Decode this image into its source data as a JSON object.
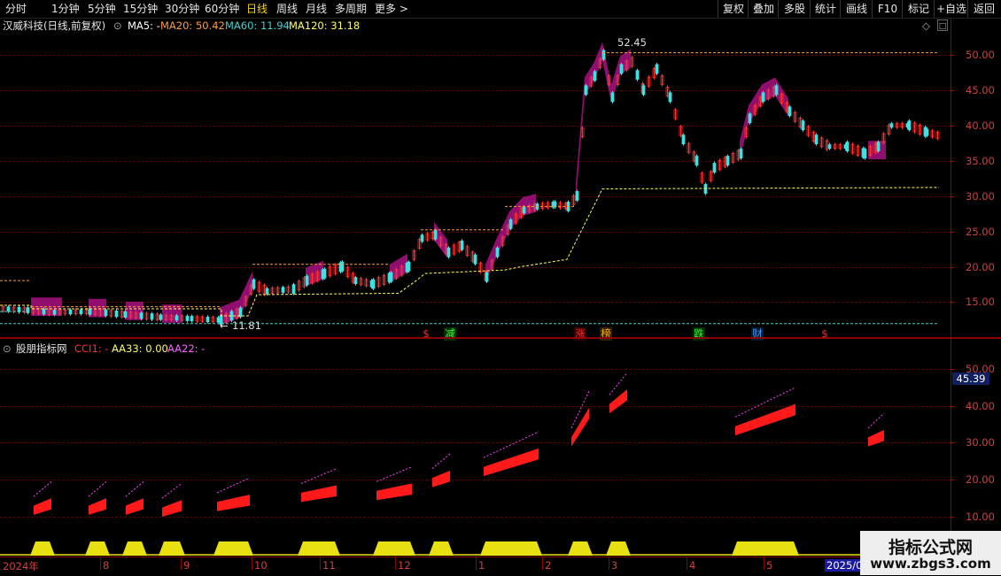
{
  "toolbar": {
    "periods": [
      "分时",
      "1分钟",
      "5分钟",
      "15分钟",
      "30分钟",
      "60分钟",
      "日线",
      "周线",
      "月线",
      "多周期",
      "更多 >"
    ],
    "active": "日线",
    "right_buttons": [
      "复权",
      "叠加",
      "多股",
      "统计",
      "画线",
      "F10",
      "标记",
      "+自选",
      "返回"
    ]
  },
  "main_panel": {
    "title": "汉威科技(日线,前复权)",
    "ma5": "MA5: -",
    "ma20": "MA20: 50.42",
    "ma60": "MA60: 11.94",
    "ma120": "MA120: 31.18",
    "high_label": "52.45",
    "low_label": "11.81",
    "y_ticks": [
      "50.00",
      "45.00",
      "40.00",
      "35.00",
      "30.00",
      "25.00",
      "20.00",
      "15.00"
    ],
    "signals": [
      {
        "text": "$",
        "color": "#ff3030"
      },
      {
        "text": "减",
        "color": "#30ff30"
      },
      {
        "text": "涨",
        "color": "#ff3030"
      },
      {
        "text": "榜",
        "color": "#ffb000"
      },
      {
        "text": "跌",
        "color": "#30ff30"
      },
      {
        "text": "财",
        "color": "#40a0ff"
      },
      {
        "text": "$",
        "color": "#ff3030"
      }
    ]
  },
  "sub_panel": {
    "title": "股朋指标网",
    "cci": "CCI1: -",
    "aa33": "AA33: 0.00",
    "aa22": "AA22: -",
    "current_value": "45.39",
    "y_ticks": [
      "50.00",
      "40.00",
      "30.00",
      "20.00",
      "10.00"
    ]
  },
  "dates": [
    "2024年",
    "8",
    "9",
    "10",
    "11",
    "12",
    "1",
    "2",
    "3",
    "4",
    "5",
    "2025/0"
  ],
  "watermark": {
    "title": "指标公式网",
    "url": "www.zbgs3.com"
  },
  "colors": {
    "up": "#ff3030",
    "down": "#40e0e0",
    "band": "#a0107a",
    "ma_dashed": "#ffff60",
    "grid": "#5c0000"
  }
}
